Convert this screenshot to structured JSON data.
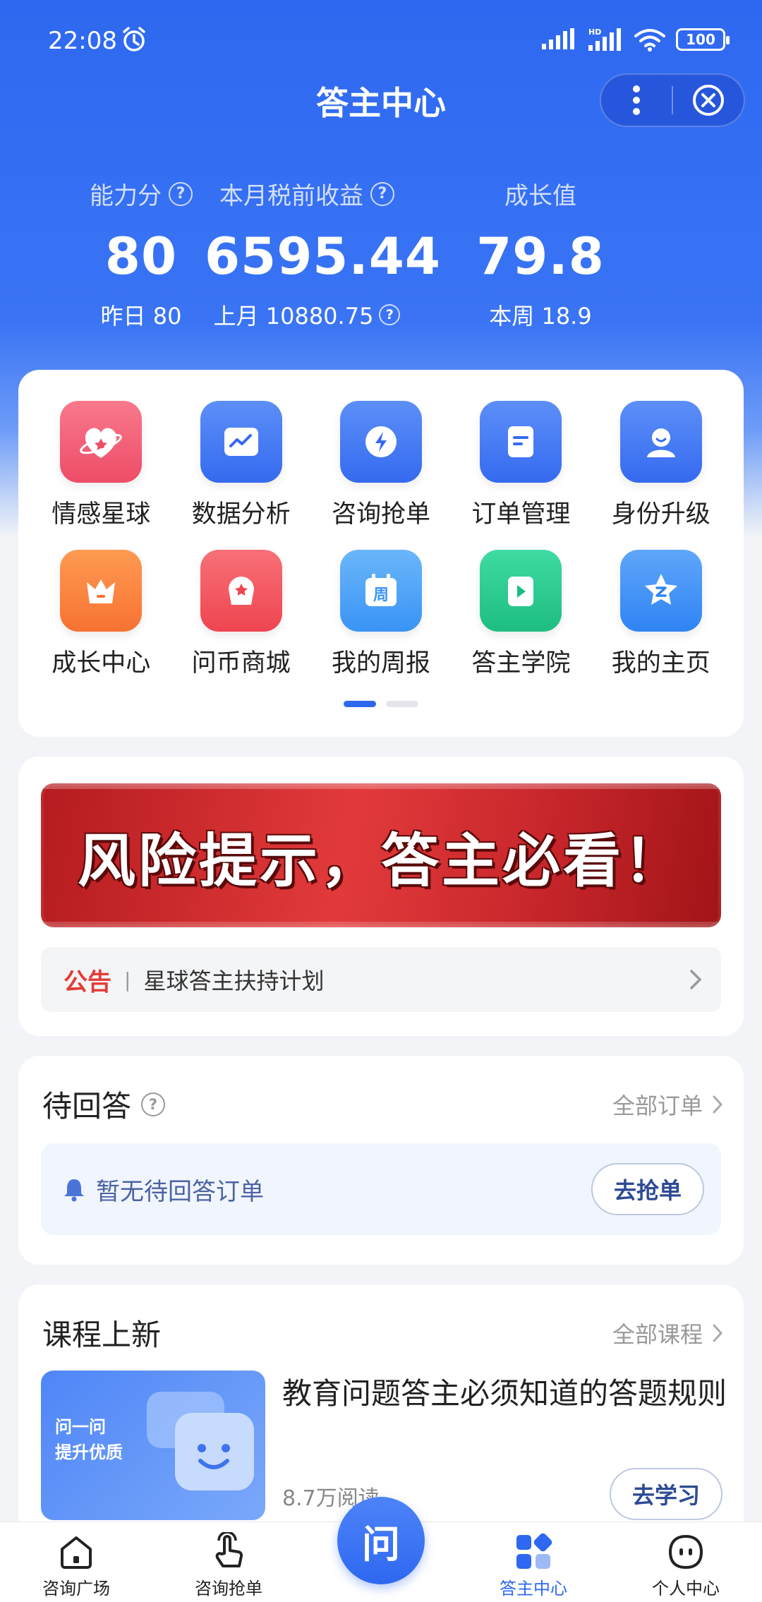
{
  "status_bar": {
    "time": "22:08",
    "battery": "100",
    "network": "HD"
  },
  "header": {
    "title": "答主中心"
  },
  "stats": [
    {
      "label": "能力分",
      "value": "80",
      "sub": "昨日 80"
    },
    {
      "label": "本月税前收益",
      "value": "6595.44",
      "sub": "上月 10880.75"
    },
    {
      "label": "成长值",
      "value": "79.8",
      "sub": "本周 18.9"
    }
  ],
  "grid": {
    "items": [
      {
        "label": "情感星球",
        "icon": "heart-planet-icon",
        "color": "#f15b73"
      },
      {
        "label": "数据分析",
        "icon": "chart-icon",
        "color": "#3f72f2"
      },
      {
        "label": "咨询抢单",
        "icon": "lightning-icon",
        "color": "#3f72f2"
      },
      {
        "label": "订单管理",
        "icon": "document-icon",
        "color": "#3f72f2"
      },
      {
        "label": "身份升级",
        "icon": "person-icon",
        "color": "#3f72f2"
      },
      {
        "label": "成长中心",
        "icon": "crown-icon",
        "color": "#fb7a35"
      },
      {
        "label": "问币商城",
        "icon": "gift-bag-icon",
        "color": "#f04d57"
      },
      {
        "label": "我的周报",
        "icon": "calendar-icon",
        "color": "#4a9ff7"
      },
      {
        "label": "答主学院",
        "icon": "play-book-icon",
        "color": "#25c98e"
      },
      {
        "label": "我的主页",
        "icon": "star-z-icon",
        "color": "#3b8ef7"
      }
    ],
    "page_dots": 2,
    "active_page": 1
  },
  "banner": {
    "text": "风险提示，答主必看！"
  },
  "notice": {
    "tag": "公告",
    "separator": "|",
    "text": "星球答主扶持计划"
  },
  "pending": {
    "title": "待回答",
    "more": "全部订单",
    "empty_text": "暂无待回答订单",
    "button": "去抢单"
  },
  "courses": {
    "title": "课程上新",
    "more": "全部课程",
    "item": {
      "thumb_text_1": "问一问",
      "thumb_text_2": "提升优质",
      "title": "教育问题答主必须知道的答题规则",
      "reads": "8.7万阅读",
      "button": "去学习"
    }
  },
  "tabbar": {
    "tabs": [
      {
        "label": "咨询广场",
        "icon": "home-icon"
      },
      {
        "label": "咨询抢单",
        "icon": "tap-hand-icon"
      },
      {
        "label": "",
        "icon": "ask-center-icon",
        "center_glyph": "问"
      },
      {
        "label": "答主中心",
        "icon": "grid-apps-icon",
        "active": true
      },
      {
        "label": "个人中心",
        "icon": "profile-face-icon"
      }
    ]
  },
  "colors": {
    "primary": "#2e68f0",
    "notice_red": "#e33b35",
    "banner_red": "#d42e31"
  }
}
